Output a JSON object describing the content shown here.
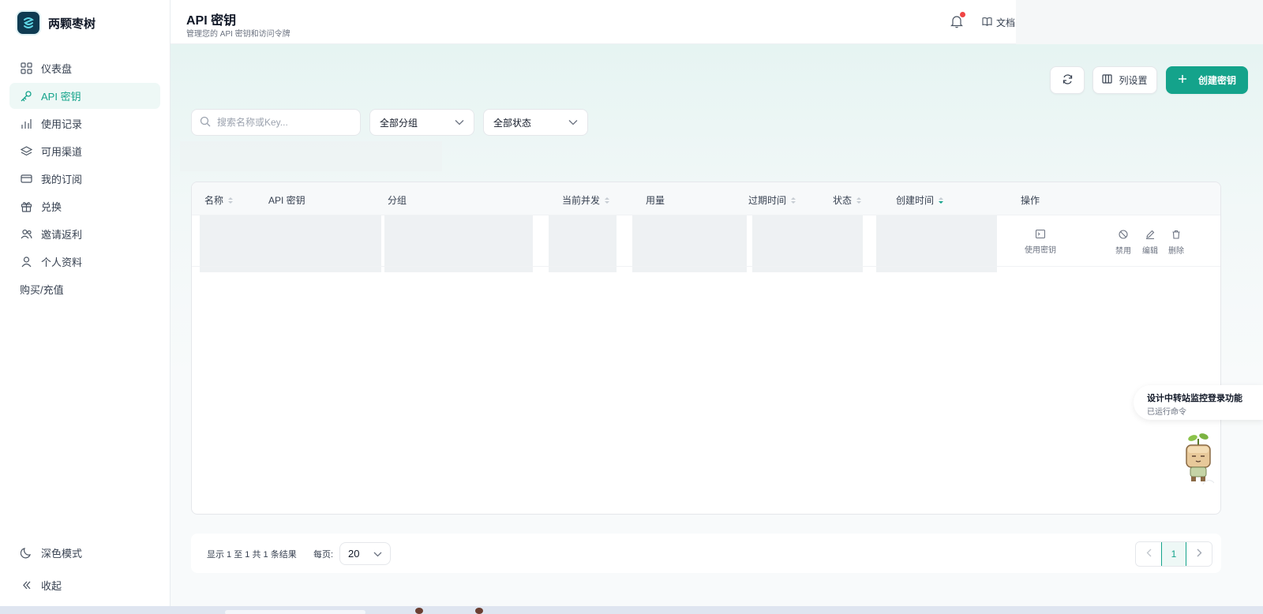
{
  "brand": {
    "name": "两颗枣树"
  },
  "sidebar": {
    "items": [
      {
        "label": "仪表盘",
        "icon": "dashboard-icon"
      },
      {
        "label": "API 密钥",
        "icon": "key-icon",
        "active": true
      },
      {
        "label": "使用记录",
        "icon": "bar-chart-icon"
      },
      {
        "label": "可用渠道",
        "icon": "layers-icon"
      },
      {
        "label": "我的订阅",
        "icon": "credit-card-icon"
      },
      {
        "label": "兑换",
        "icon": "gift-icon"
      },
      {
        "label": "邀请返利",
        "icon": "users-icon"
      },
      {
        "label": "个人资料",
        "icon": "user-icon"
      },
      {
        "label": "购买/充值",
        "icon": ""
      }
    ],
    "bottom": [
      {
        "label": "深色模式",
        "icon": "moon-icon"
      },
      {
        "label": "收起",
        "icon": "collapse-icon"
      }
    ]
  },
  "header": {
    "title": "API 密钥",
    "subtitle": "管理您的 API 密钥和访问令牌",
    "docs_label": "文档"
  },
  "toolbar": {
    "columns_label": "列设置",
    "create_label": "创建密钥"
  },
  "filters": {
    "search_placeholder": "搜索名称或Key...",
    "group_select": "全部分组",
    "status_select": "全部状态"
  },
  "table": {
    "columns": [
      "名称",
      "API 密钥",
      "分组",
      "当前并发",
      "用量",
      "过期时间",
      "状态",
      "创建时间",
      "操作"
    ],
    "row_actions": {
      "use_key": "使用密钥",
      "disable": "禁用",
      "edit": "编辑",
      "delete": "删除"
    }
  },
  "pagination": {
    "summary": "显示 1 至 1 共 1 条结果",
    "per_page_label": "每页:",
    "per_page_value": "20",
    "current_page": "1"
  },
  "notice": {
    "title": "设计中转站监控登录功能",
    "subtitle": "已运行命令"
  },
  "colors": {
    "accent": "#14a38b",
    "badge": "#ef4444"
  }
}
